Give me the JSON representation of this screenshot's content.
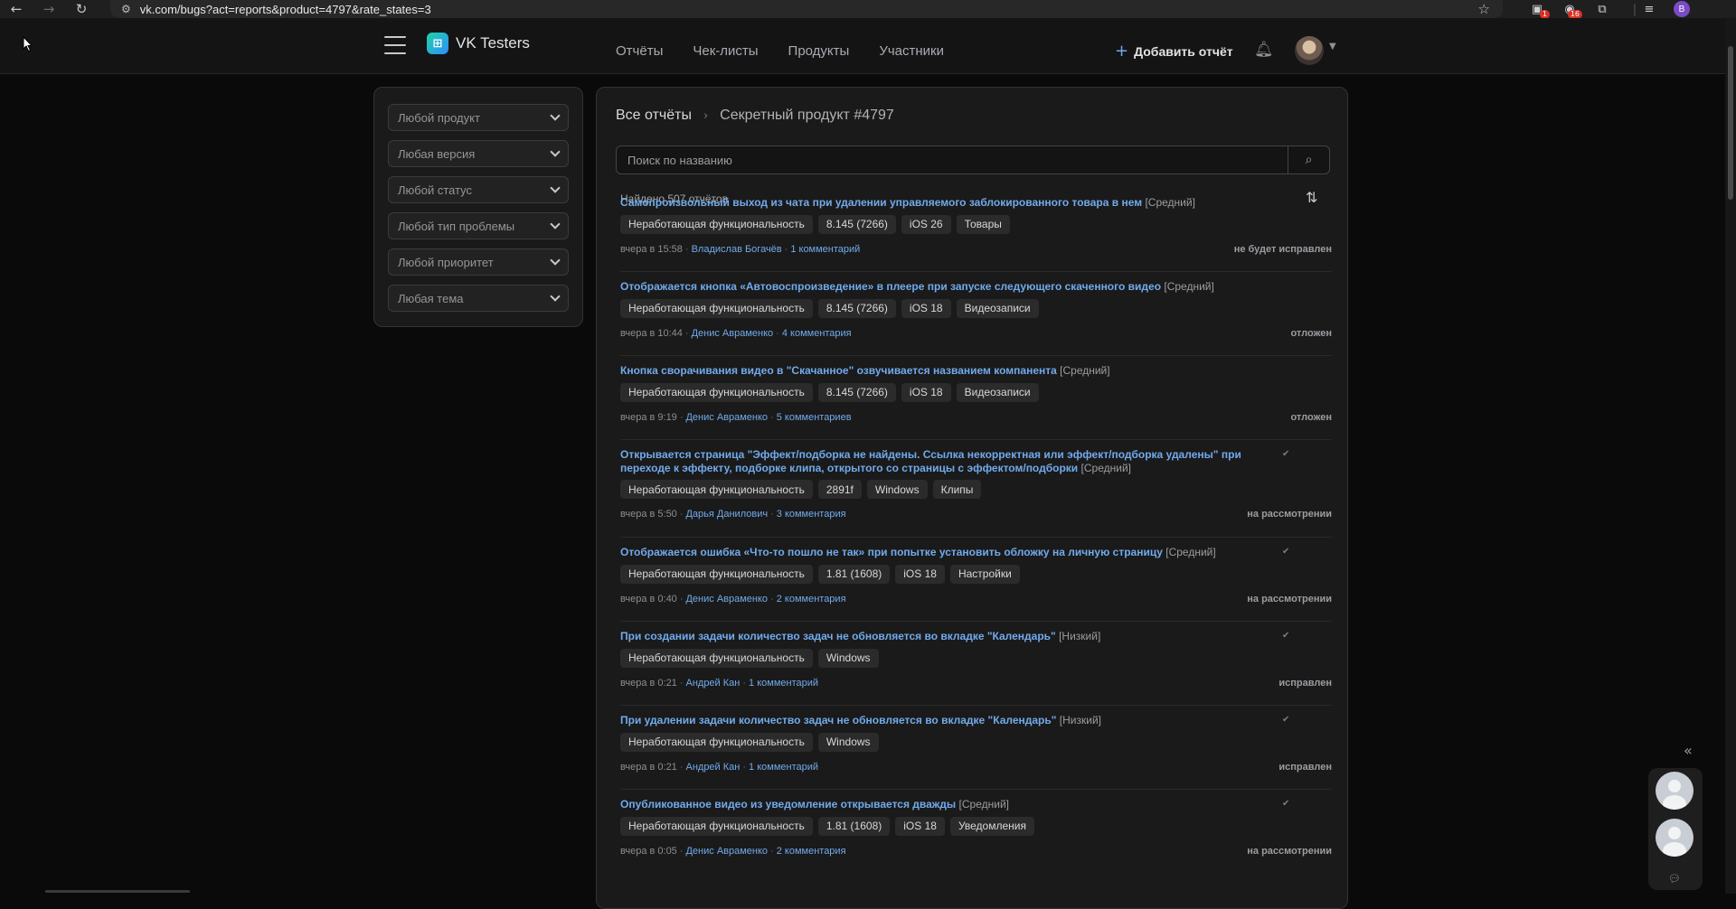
{
  "browser": {
    "url": "vk.com/bugs?act=reports&product=4797&rate_states=3",
    "ext_badge_1": "1",
    "ext_badge_2": "16",
    "profile_letter": "B"
  },
  "header": {
    "logo_text": "VK Testers",
    "nav": [
      "Отчёты",
      "Чек-листы",
      "Продукты",
      "Участники"
    ],
    "add_report": "Добавить отчёт"
  },
  "filters": [
    "Любой продукт",
    "Любая версия",
    "Любой статус",
    "Любой тип проблемы",
    "Любой приоритет",
    "Любая тема"
  ],
  "main": {
    "breadcrumb_root": "Все отчёты",
    "breadcrumb_current": "Секретный продукт #4797",
    "search_placeholder": "Поиск по названию",
    "found": "Найдено 507 отчётов"
  },
  "reports": [
    {
      "title": "Самопроизвольный выход из чата при удалении управляемого заблокированного товара в нем",
      "priority": "[Средний]",
      "tags": [
        "Неработающая функциональность",
        "8.145 (7266)",
        "iOS 26",
        "Товары"
      ],
      "time": "вчера в 15:58",
      "author": "Владислав Богачёв",
      "comments": "1 комментарий",
      "status": "не будет исправлен",
      "checked": false
    },
    {
      "title": "Отображается кнопка «Автовоспроизведение» в плеере при запуске следующего скаченного видео",
      "priority": "[Средний]",
      "tags": [
        "Неработающая функциональность",
        "8.145 (7266)",
        "iOS 18",
        "Видеозаписи"
      ],
      "time": "вчера в 10:44",
      "author": "Денис Авраменко",
      "comments": "4 комментария",
      "status": "отложен",
      "checked": false
    },
    {
      "title": "Кнопка сворачивания видео в \"Скачанное\" озвучивается названием компанента",
      "priority": "[Средний]",
      "tags": [
        "Неработающая функциональность",
        "8.145 (7266)",
        "iOS 18",
        "Видеозаписи"
      ],
      "time": "вчера в 9:19",
      "author": "Денис Авраменко",
      "comments": "5 комментариев",
      "status": "отложен",
      "checked": false
    },
    {
      "title": "Открывается страница \"Эффект/подборка не найдены. Ссылка некорректная или эффект/подборка удалены\" при переходе к эффекту, подборке клипа, открытого со страницы с эффектом/подборки",
      "priority": "[Средний]",
      "tags": [
        "Неработающая функциональность",
        "2891f",
        "Windows",
        "Клипы"
      ],
      "time": "вчера в 5:50",
      "author": "Дарья Данилович",
      "comments": "3 комментария",
      "status": "на рассмотрении",
      "checked": true
    },
    {
      "title": "Отображается ошибка «Что-то пошло не так» при попытке установить обложку на личную страницу",
      "priority": "[Средний]",
      "tags": [
        "Неработающая функциональность",
        "1.81 (1608)",
        "iOS 18",
        "Настройки"
      ],
      "time": "вчера в 0:40",
      "author": "Денис Авраменко",
      "comments": "2 комментария",
      "status": "на рассмотрении",
      "checked": true
    },
    {
      "title": "При создании задачи количество задач не обновляется во вкладке \"Календарь\"",
      "priority": "[Низкий]",
      "tags": [
        "Неработающая функциональность",
        "Windows"
      ],
      "time": "вчера в 0:21",
      "author": "Андрей Кан",
      "comments": "1 комментарий",
      "status": "исправлен",
      "checked": true
    },
    {
      "title": "При удалении задачи количество задач не обновляется во вкладке \"Календарь\"",
      "priority": "[Низкий]",
      "tags": [
        "Неработающая функциональность",
        "Windows"
      ],
      "time": "вчера в 0:21",
      "author": "Андрей Кан",
      "comments": "1 комментарий",
      "status": "исправлен",
      "checked": true
    },
    {
      "title": "Опубликованное видео из уведомление открывается дважды",
      "priority": "[Средний]",
      "tags": [
        "Неработающая функциональность",
        "1.81 (1608)",
        "iOS 18",
        "Уведомления"
      ],
      "time": "вчера в 0:05",
      "author": "Денис Авраменко",
      "comments": "2 комментария",
      "status": "на рассмотрении",
      "checked": true
    }
  ],
  "colors": {
    "link": "#71aaeb",
    "background": "#0a0a0a",
    "panel": "#1a1a1a"
  }
}
